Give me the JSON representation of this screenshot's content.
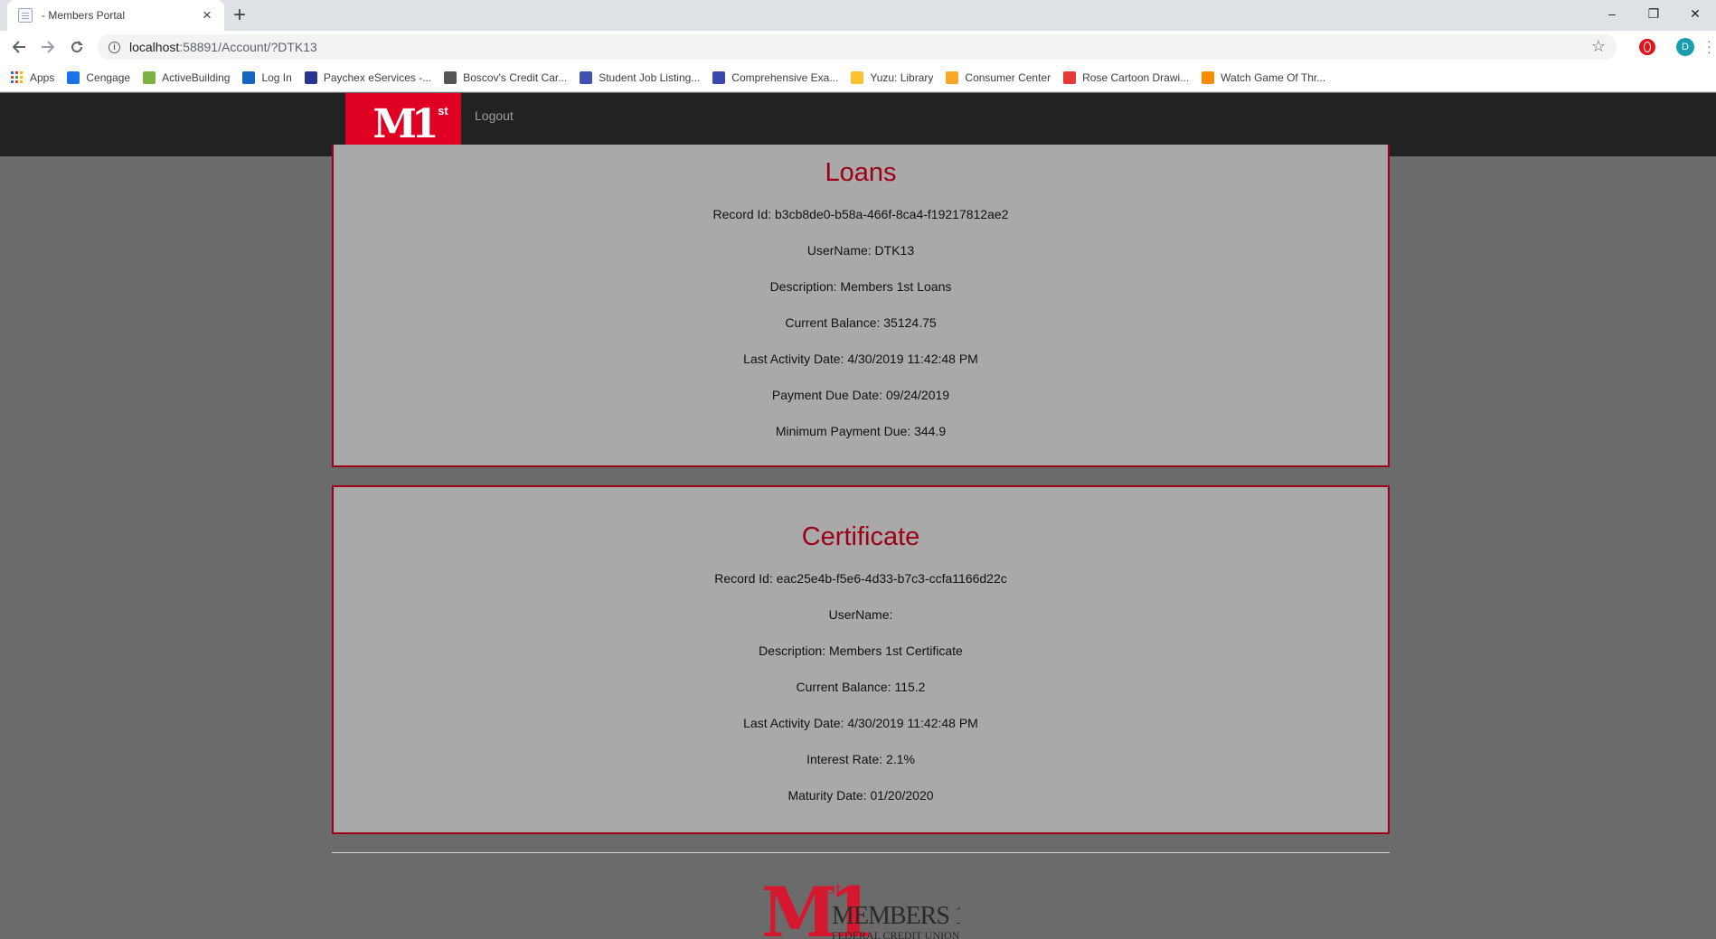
{
  "browser": {
    "tab_title": "- Members Portal",
    "tab_close": "×",
    "new_tab": "+",
    "url_host": "localhost",
    "url_rest": ":58891/Account/?DTK13",
    "profile_initial": "D",
    "window_controls": {
      "minimize": "–",
      "restore": "❐",
      "close": "✕"
    },
    "bookmarks": [
      {
        "label": "Apps"
      },
      {
        "label": "Cengage",
        "color": "#1a73e8"
      },
      {
        "label": "ActiveBuilding",
        "color": "#7cb342"
      },
      {
        "label": "Log In",
        "color": "#1565c0"
      },
      {
        "label": "Paychex eServices -...",
        "color": "#283593"
      },
      {
        "label": "Boscov's Credit Car...",
        "color": "#555555"
      },
      {
        "label": "Student Job Listing...",
        "color": "#3f51b5"
      },
      {
        "label": "Comprehensive Exa...",
        "color": "#3949ab"
      },
      {
        "label": "Yuzu: Library",
        "color": "#fbc02d"
      },
      {
        "label": "Consumer Center",
        "color": "#f9a825"
      },
      {
        "label": "Rose Cartoon Drawi...",
        "color": "#e53935"
      },
      {
        "label": "Watch Game Of Thr...",
        "color": "#fb8c00"
      }
    ]
  },
  "nav": {
    "brand_text": "M1",
    "brand_sup": "st",
    "logout_label": "Logout"
  },
  "loans": {
    "title": "Loans",
    "record_id": "Record Id: b3cb8de0-b58a-466f-8ca4-f19217812ae2",
    "username": "UserName: DTK13",
    "description": "Description: Members 1st Loans",
    "current_balance": "Current Balance: 35124.75",
    "last_activity": "Last Activity Date: 4/30/2019 11:42:48 PM",
    "payment_due": "Payment Due Date: 09/24/2019",
    "minimum_payment": "Minimum Payment Due: 344.9"
  },
  "certificate": {
    "title": "Certificate",
    "record_id": "Record Id: eac25e4b-f5e6-4d33-b7c3-ccfa1166d22c",
    "username": "UserName:",
    "description": "Description: Members 1st Certificate",
    "current_balance": "Current Balance: 115.2",
    "last_activity": "Last Activity Date: 4/30/2019 11:42:48 PM",
    "interest_rate": "Interest Rate: 2.1%",
    "maturity_date": "Maturity Date: 01/20/2020"
  },
  "footer": {
    "logo_m": "M1",
    "logo_st": "st",
    "logo_name": "MEMBERS 1",
    "logo_name_sup": "st",
    "logo_sub": "FEDERAL CREDIT UNION"
  },
  "colors": {
    "brand_red": "#e00022",
    "card_border": "#9b0017",
    "card_bg": "#a9a9a9",
    "page_bg": "#6b6b6b",
    "nav_bg": "#222222"
  }
}
